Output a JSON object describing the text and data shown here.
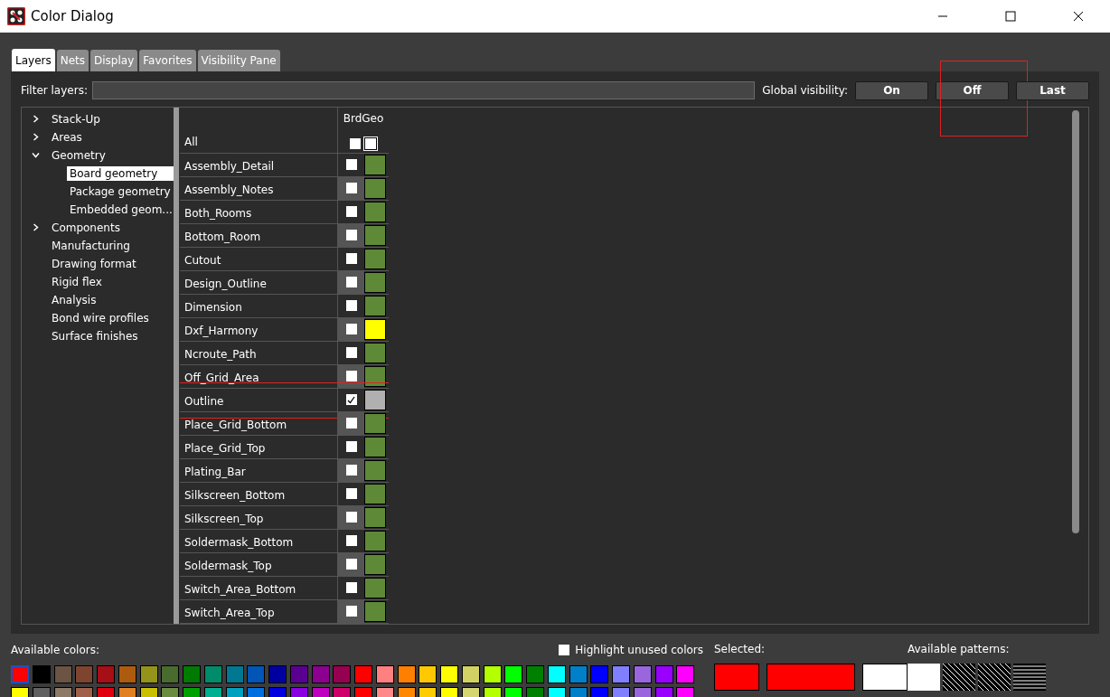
{
  "window": {
    "title": "Color Dialog"
  },
  "tabs": [
    {
      "label": "Layers",
      "selected": true
    },
    {
      "label": "Nets",
      "selected": false
    },
    {
      "label": "Display",
      "selected": false
    },
    {
      "label": "Favorites",
      "selected": false
    },
    {
      "label": "Visibility Pane",
      "selected": false
    }
  ],
  "filter": {
    "label": "Filter layers:"
  },
  "global_visibility": {
    "label": "Global visibility:",
    "buttons": [
      {
        "label": "On",
        "highlighted": false
      },
      {
        "label": "Off",
        "highlighted": true
      },
      {
        "label": "Last",
        "highlighted": false
      }
    ]
  },
  "tree": [
    {
      "label": "Stack-Up",
      "expanded": false,
      "selected": false
    },
    {
      "label": "Areas",
      "expanded": false,
      "selected": false
    },
    {
      "label": "Geometry",
      "expanded": true,
      "selected": false,
      "children": [
        {
          "label": "Board geometry",
          "selected": true
        },
        {
          "label": "Package geometry",
          "selected": false
        },
        {
          "label": "Embedded geom...",
          "selected": false
        }
      ]
    },
    {
      "label": "Components",
      "expanded": false,
      "selected": false
    },
    {
      "label": "Manufacturing",
      "selected": false
    },
    {
      "label": "Drawing format",
      "selected": false
    },
    {
      "label": "Rigid flex",
      "selected": false
    },
    {
      "label": "Analysis",
      "selected": false
    },
    {
      "label": "Bond wire profiles",
      "selected": false
    },
    {
      "label": "Surface finishes",
      "selected": false
    }
  ],
  "layers": {
    "column": "BrdGeo",
    "all_label": "All",
    "all_checked": false,
    "rows": [
      {
        "name": "Assembly_Detail",
        "checked": false,
        "color": "#5e8a37",
        "highlighted": false
      },
      {
        "name": "Assembly_Notes",
        "checked": false,
        "color": "#5e8a37",
        "highlighted": false
      },
      {
        "name": "Both_Rooms",
        "checked": false,
        "color": "#5e8a37",
        "highlighted": false
      },
      {
        "name": "Bottom_Room",
        "checked": false,
        "color": "#5e8a37",
        "highlighted": false
      },
      {
        "name": "Cutout",
        "checked": false,
        "color": "#5e8a37",
        "highlighted": false
      },
      {
        "name": "Design_Outline",
        "checked": false,
        "color": "#5e8a37",
        "highlighted": false
      },
      {
        "name": "Dimension",
        "checked": false,
        "color": "#5e8a37",
        "highlighted": false
      },
      {
        "name": "Dxf_Harmony",
        "checked": false,
        "color": "#ffff00",
        "highlighted": false
      },
      {
        "name": "Ncroute_Path",
        "checked": false,
        "color": "#5e8a37",
        "highlighted": false
      },
      {
        "name": "Off_Grid_Area",
        "checked": false,
        "color": "#5e8a37",
        "highlighted": false
      },
      {
        "name": "Outline",
        "checked": true,
        "color": "#b0b0b0",
        "highlighted": true
      },
      {
        "name": "Place_Grid_Bottom",
        "checked": false,
        "color": "#5e8a37",
        "highlighted": false
      },
      {
        "name": "Place_Grid_Top",
        "checked": false,
        "color": "#5e8a37",
        "highlighted": false
      },
      {
        "name": "Plating_Bar",
        "checked": false,
        "color": "#5e8a37",
        "highlighted": false
      },
      {
        "name": "Silkscreen_Bottom",
        "checked": false,
        "color": "#5e8a37",
        "highlighted": false
      },
      {
        "name": "Silkscreen_Top",
        "checked": false,
        "color": "#5e8a37",
        "highlighted": false
      },
      {
        "name": "Soldermask_Bottom",
        "checked": false,
        "color": "#5e8a37",
        "highlighted": false
      },
      {
        "name": "Soldermask_Top",
        "checked": false,
        "color": "#5e8a37",
        "highlighted": false
      },
      {
        "name": "Switch_Area_Bottom",
        "checked": false,
        "color": "#5e8a37",
        "highlighted": false
      },
      {
        "name": "Switch_Area_Top",
        "checked": false,
        "color": "#5e8a37",
        "highlighted": false
      }
    ]
  },
  "available_colors": {
    "label": "Available colors:",
    "swatches": [
      {
        "color": "#ff0000",
        "selected": true
      },
      {
        "color": "#000000",
        "selected": false
      },
      {
        "color": "#6b5444",
        "selected": false
      },
      {
        "color": "#7d4430",
        "selected": false
      },
      {
        "color": "#a50f15",
        "selected": false
      },
      {
        "color": "#ad5c0f",
        "selected": false
      },
      {
        "color": "#94941a",
        "selected": false
      },
      {
        "color": "#4a6b2e",
        "selected": false
      },
      {
        "color": "#007a00",
        "selected": false
      },
      {
        "color": "#008c6b",
        "selected": false
      },
      {
        "color": "#007891",
        "selected": false
      },
      {
        "color": "#0055b5",
        "selected": false
      },
      {
        "color": "#0000a0",
        "selected": false
      },
      {
        "color": "#5a0090",
        "selected": false
      },
      {
        "color": "#8c0090",
        "selected": false
      },
      {
        "color": "#960050",
        "selected": false
      },
      {
        "color": "#ff0000",
        "selected": false
      },
      {
        "color": "#ff8080",
        "selected": false
      },
      {
        "color": "#ff8000",
        "selected": false
      },
      {
        "color": "#ffc800",
        "selected": false
      },
      {
        "color": "#ffff00",
        "selected": false
      },
      {
        "color": "#d2d264",
        "selected": false
      },
      {
        "color": "#b4ff00",
        "selected": false
      },
      {
        "color": "#00ff00",
        "selected": false
      },
      {
        "color": "#008000",
        "selected": false
      },
      {
        "color": "#00ffff",
        "selected": false
      },
      {
        "color": "#0080c8",
        "selected": false
      },
      {
        "color": "#0000ff",
        "selected": false
      },
      {
        "color": "#8080ff",
        "selected": false
      },
      {
        "color": "#9966dd",
        "selected": false
      },
      {
        "color": "#9900ff",
        "selected": false
      },
      {
        "color": "#ff00ff",
        "selected": false
      },
      {
        "color": "#ffff00",
        "selected": false
      },
      {
        "color": "#606060",
        "selected": false
      },
      {
        "color": "#8c7a66",
        "selected": false
      },
      {
        "color": "#a0604a",
        "selected": false
      },
      {
        "color": "#e00010",
        "selected": false
      },
      {
        "color": "#e08020",
        "selected": false
      },
      {
        "color": "#c8c000",
        "selected": false
      },
      {
        "color": "#6a8c40",
        "selected": false
      },
      {
        "color": "#00a000",
        "selected": false
      },
      {
        "color": "#00b090",
        "selected": false
      },
      {
        "color": "#00a0c0",
        "selected": false
      },
      {
        "color": "#0070e0",
        "selected": false
      },
      {
        "color": "#0000e0",
        "selected": false
      },
      {
        "color": "#8a00e0",
        "selected": false
      },
      {
        "color": "#c000c0",
        "selected": false
      },
      {
        "color": "#d0006a",
        "selected": false
      },
      {
        "color": "#ff0000",
        "selected": false
      },
      {
        "color": "#ff8888",
        "selected": false
      },
      {
        "color": "#ff8800",
        "selected": false
      },
      {
        "color": "#ffcc00",
        "selected": false
      },
      {
        "color": "#ffff00",
        "selected": false
      },
      {
        "color": "#d6d670",
        "selected": false
      },
      {
        "color": "#b4ff00",
        "selected": false
      },
      {
        "color": "#00ff00",
        "selected": false
      },
      {
        "color": "#008000",
        "selected": false
      },
      {
        "color": "#00ffff",
        "selected": false
      },
      {
        "color": "#0080c8",
        "selected": false
      },
      {
        "color": "#0000ff",
        "selected": false
      },
      {
        "color": "#8080ff",
        "selected": false
      },
      {
        "color": "#9966dd",
        "selected": false
      },
      {
        "color": "#9900ff",
        "selected": false
      },
      {
        "color": "#ff00ff",
        "selected": false
      }
    ]
  },
  "highlight_unused": {
    "label": "Highlight unused colors",
    "checked": false
  },
  "selected": {
    "label": "Selected:",
    "previews": [
      {
        "color": "#ff0000"
      },
      {
        "color": "#ff0000"
      },
      {
        "color": "#ffffff"
      }
    ]
  },
  "patterns": {
    "label": "Available patterns:",
    "items": [
      {
        "kind": "solid"
      },
      {
        "kind": "diagonal"
      },
      {
        "kind": "diagonal"
      },
      {
        "kind": "horizontal"
      }
    ]
  }
}
